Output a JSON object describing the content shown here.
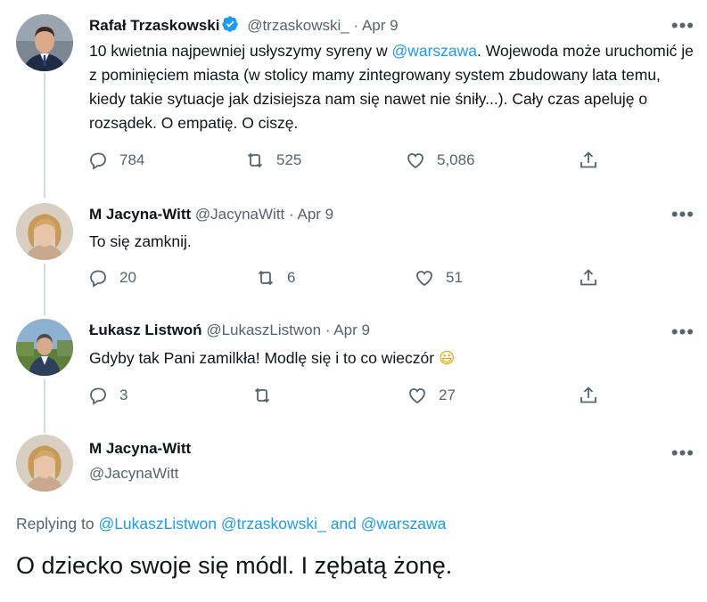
{
  "tweets": [
    {
      "name": "Rafał Trzaskowski",
      "handle": "@trzaskowski_",
      "dot": "·",
      "date": "Apr 9",
      "text_before": "10 kwietnia najpewniej usłyszymy syreny w ",
      "mention": "@warszawa",
      "text_after": ". Wojewoda może uruchomić je z pominięciem miasta (w stolicy mamy zintegrowany system zbudowany lata temu, kiedy takie sytuacje jak dzisiejsza nam się nawet nie śniły...). Cały czas apeluję o rozsądek. O empatię. O ciszę.",
      "replies": "784",
      "retweets": "525",
      "likes": "5,086"
    },
    {
      "name": "M Jacyna-Witt",
      "handle": "@JacynaWitt",
      "dot": "·",
      "date": "Apr 9",
      "text": "To się zamknij.",
      "replies": "20",
      "retweets": "6",
      "likes": "51"
    },
    {
      "name": "Łukasz Listwoń",
      "handle": "@LukaszListwon",
      "dot": "·",
      "date": "Apr 9",
      "text": "Gdyby tak Pani zamilkła! Modlę się i to co wieczór",
      "emoji": "😃",
      "replies": "3",
      "retweets": "",
      "likes": "27"
    }
  ],
  "main": {
    "name": "M Jacyna-Witt",
    "handle": "@JacynaWitt",
    "replying_prefix": "Replying to",
    "replying_mentions": [
      "@LukaszListwon",
      "@trzaskowski_",
      "and",
      "@warszawa"
    ],
    "text": "O dziecko swoje się módl. I zębatą żonę."
  },
  "icons": {
    "more": "more-icon",
    "reply": "reply-icon",
    "retweet": "retweet-icon",
    "like": "like-icon",
    "share": "share-icon",
    "verified": "verified-badge-icon"
  },
  "colors": {
    "accent": "#1d9bf0",
    "muted": "#536471",
    "text": "#0f1419",
    "thread": "#cfd9de"
  }
}
